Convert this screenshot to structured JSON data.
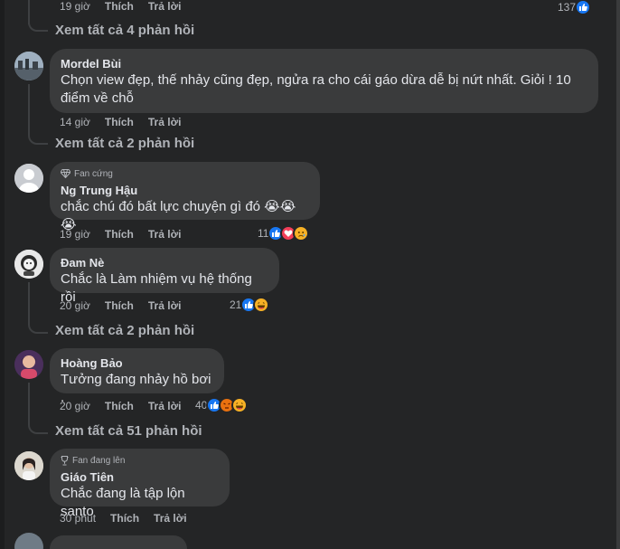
{
  "top": {
    "time": "19 giờ",
    "like": "Thích",
    "reply": "Trả lời",
    "reaction_count": "137",
    "view_replies": "Xem tất cả 4 phản hồi"
  },
  "comments": [
    {
      "author": "Mordel Bùi",
      "badge": "",
      "text_line1": "Chọn view đẹp, thế nhảy cũng đẹp, ngửa ra cho cái gáo dừa dễ bị nứt nhất. Giỏi ! 10",
      "text_line2": "điểm về chỗ",
      "time": "14 giờ",
      "like": "Thích",
      "reply": "Trả lời",
      "reaction_count": "",
      "view_replies": "Xem tất cả 2 phản hồi"
    },
    {
      "author": "Ng Trung Hậu",
      "badge": "Fan cứng",
      "text": "chắc chú đó bất lực chuyện gì đó 😭😭😭",
      "time": "19 giờ",
      "like": "Thích",
      "reply": "Trả lời",
      "reaction_count": "11",
      "reactions": [
        "like-icon",
        "love-icon",
        "sad-icon"
      ]
    },
    {
      "author": "Đam Nè",
      "badge": "",
      "text": "Chắc là Làm nhiệm vụ hệ thống rồi",
      "time": "20 giờ",
      "like": "Thích",
      "reply": "Trả lời",
      "reaction_count": "21",
      "reactions": [
        "like-icon",
        "haha-icon"
      ],
      "view_replies": "Xem tất cả 2 phản hồi"
    },
    {
      "author": "Hoàng Bảo",
      "badge": "",
      "text": "Tưởng đang nhảy hồ bơi .",
      "time": "20 giờ",
      "like": "Thích",
      "reply": "Trả lời",
      "reaction_count": "40",
      "reactions": [
        "like-icon",
        "angry-icon",
        "haha-icon"
      ],
      "view_replies": "Xem tất cả 51 phản hồi"
    },
    {
      "author": "Giáo Tiên",
      "badge": "Fan đang lên",
      "text": "Chắc đang là tập lộn santo",
      "time": "30 phút",
      "like": "Thích",
      "reply": "Trả lời",
      "reaction_count": ""
    }
  ],
  "colors": {
    "background": "#242526",
    "bubble": "#3a3b3c",
    "text": "#e4e6eb",
    "secondary": "#b0b3b8",
    "like_blue": "#1877f2",
    "love_red": "#f33e58",
    "emoji_yellow": "#f7b125"
  }
}
